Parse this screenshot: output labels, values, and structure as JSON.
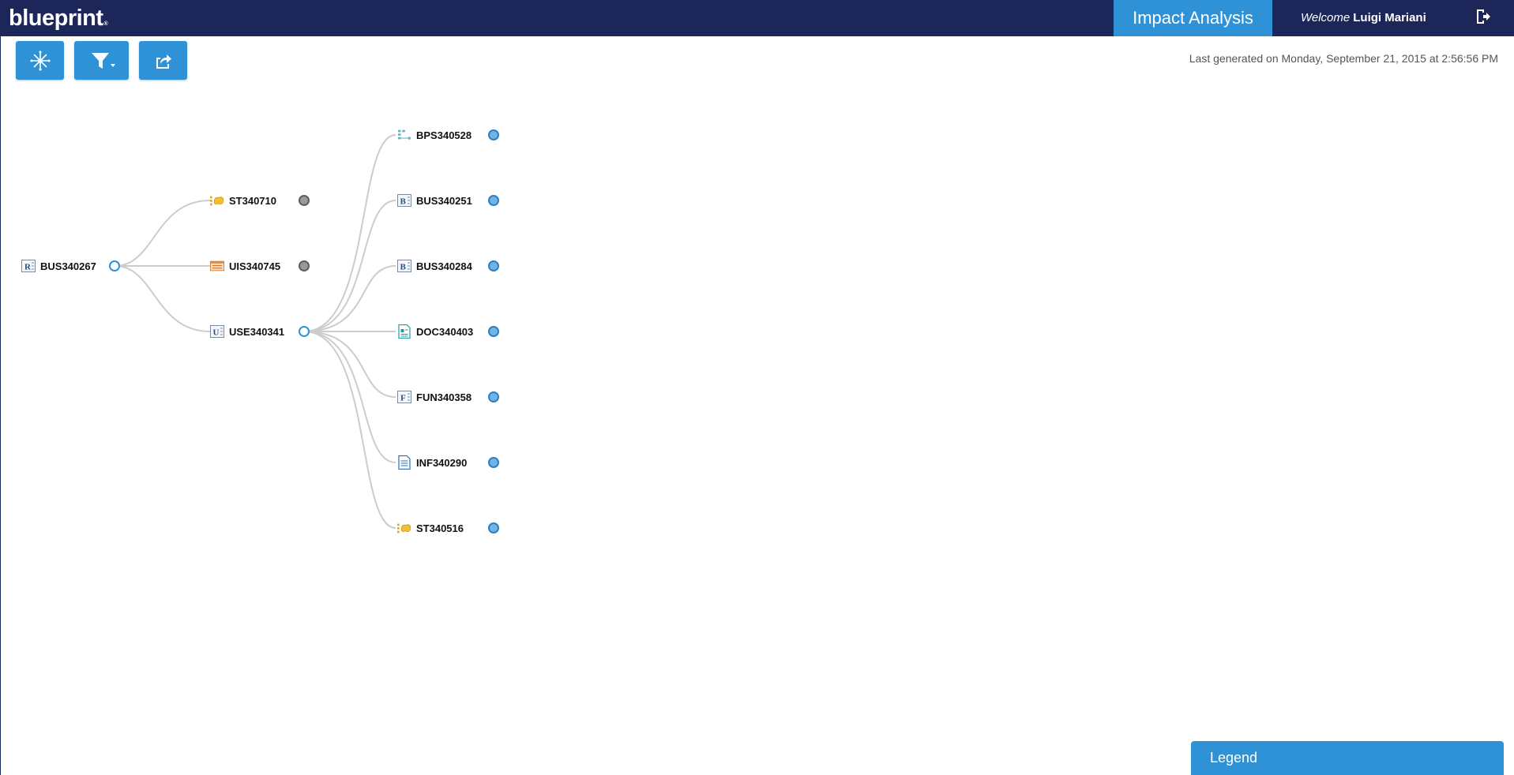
{
  "header": {
    "logo": "blueprint",
    "logo_mark": "®",
    "tab": "Impact Analysis",
    "welcome_label": "Welcome",
    "user_name": "Luigi Mariani",
    "logout_icon": "logout-icon"
  },
  "toolbar": {
    "buttons": [
      {
        "name": "center-view-button",
        "icon": "asterisk-burst-icon"
      },
      {
        "name": "filter-button",
        "icon": "filter-dropdown-icon"
      },
      {
        "name": "export-button",
        "icon": "share-export-icon"
      }
    ],
    "generated_text": "Last generated on Monday, September 21, 2015 at 2:56:56 PM"
  },
  "graph": {
    "root": {
      "id": "BUS340267",
      "icon": "requirement-icon"
    },
    "level1": [
      {
        "id": "ST340710",
        "icon": "storyboard-icon"
      },
      {
        "id": "UIS340745",
        "icon": "ui-mockup-icon"
      },
      {
        "id": "USE340341",
        "icon": "use-case-icon"
      }
    ],
    "level2": [
      {
        "id": "BPS340528",
        "icon": "process-icon"
      },
      {
        "id": "BUS340251",
        "icon": "business-rule-icon"
      },
      {
        "id": "BUS340284",
        "icon": "business-rule-icon"
      },
      {
        "id": "DOC340403",
        "icon": "document-icon"
      },
      {
        "id": "FUN340358",
        "icon": "functional-icon"
      },
      {
        "id": "INF340290",
        "icon": "info-document-icon"
      },
      {
        "id": "ST340516",
        "icon": "storyboard-icon"
      }
    ]
  },
  "legend": {
    "label": "Legend"
  },
  "colors": {
    "header_bg": "#1c2659",
    "accent": "#2f92d6",
    "link": "#cccccc"
  }
}
